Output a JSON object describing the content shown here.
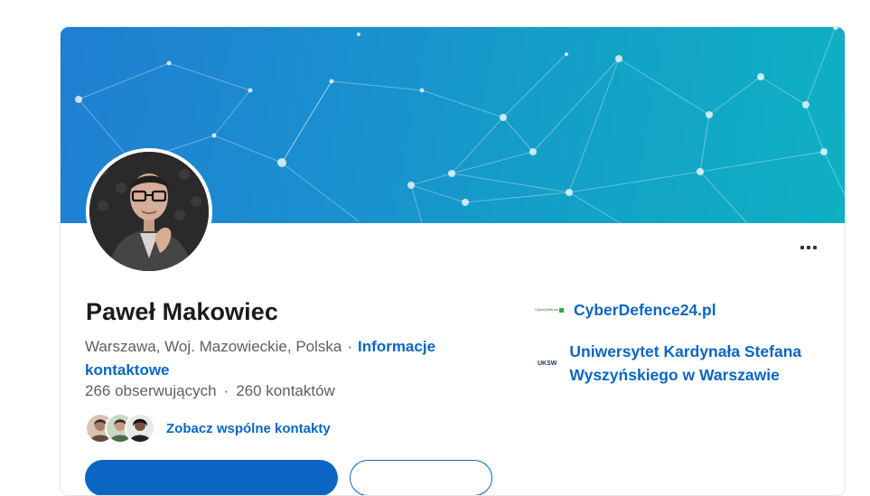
{
  "profile": {
    "name": "Paweł Makowiec",
    "location": "Warszawa, Woj. Mazowieckie, Polska",
    "separator": "·",
    "contact_info_link": "Informacje kontaktowe",
    "followers": "266 obserwujących",
    "connections": "260 kontaktów",
    "mutual_connections_link": "Zobacz wspólne kontakty"
  },
  "experience": [
    {
      "name": "CyberDefence24.pl",
      "logo_text": "CyberDefence24"
    },
    {
      "name": "Uniwersytet Kardynała Stefana Wyszyńskiego w Warszawie",
      "logo_text": "UKSW"
    }
  ],
  "colors": {
    "link": "#0a66c2",
    "cover_start": "#1f7fd2",
    "cover_end": "#0fb0c3"
  },
  "icons": {
    "more": "more-horizontal-icon"
  }
}
